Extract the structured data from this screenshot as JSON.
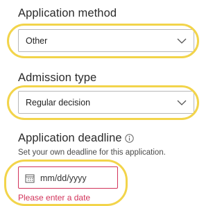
{
  "application_method": {
    "label": "Application method",
    "selected": "Other"
  },
  "admission_type": {
    "label": "Admission type",
    "selected": "Regular decision"
  },
  "application_deadline": {
    "label": "Application deadline",
    "helper": "Set your own deadline for this application.",
    "placeholder": "mm/dd/yyyy",
    "error": "Please enter a date"
  },
  "colors": {
    "highlight": "#f2d44a",
    "error": "#d2335a",
    "border": "#b8b8b8"
  },
  "icons": {
    "dropdown": "chevron-down-icon",
    "info": "info-icon",
    "calendar": "calendar-icon"
  }
}
